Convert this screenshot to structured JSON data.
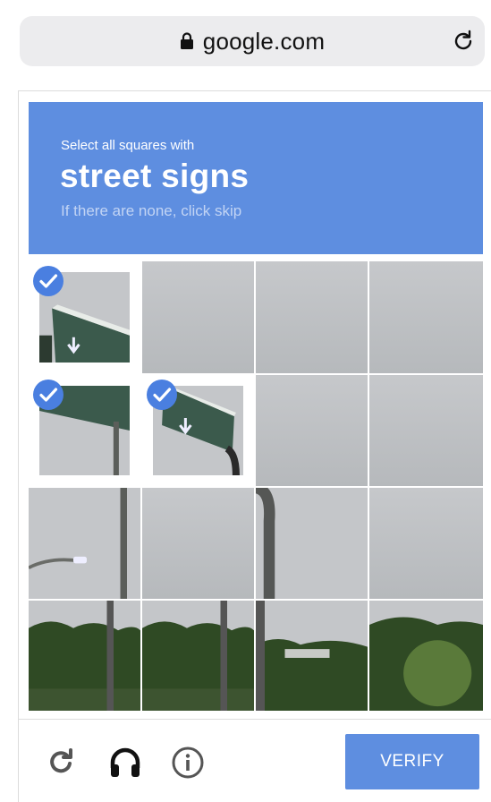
{
  "browser": {
    "url": "google.com"
  },
  "captcha": {
    "instruction": "Select all squares with",
    "target": "street signs",
    "hint": "If there are none, click skip",
    "tiles": [
      {
        "row": 0,
        "col": 0,
        "selected": true,
        "scene": "sign-top"
      },
      {
        "row": 0,
        "col": 1,
        "selected": false,
        "scene": "sky"
      },
      {
        "row": 0,
        "col": 2,
        "selected": false,
        "scene": "sky"
      },
      {
        "row": 0,
        "col": 3,
        "selected": false,
        "scene": "sky"
      },
      {
        "row": 1,
        "col": 0,
        "selected": true,
        "scene": "sign-pole"
      },
      {
        "row": 1,
        "col": 1,
        "selected": true,
        "scene": "sign-small"
      },
      {
        "row": 1,
        "col": 2,
        "selected": false,
        "scene": "sky"
      },
      {
        "row": 1,
        "col": 3,
        "selected": false,
        "scene": "sky"
      },
      {
        "row": 2,
        "col": 0,
        "selected": false,
        "scene": "pole-light"
      },
      {
        "row": 2,
        "col": 1,
        "selected": false,
        "scene": "sky"
      },
      {
        "row": 2,
        "col": 2,
        "selected": false,
        "scene": "pole-curve"
      },
      {
        "row": 2,
        "col": 3,
        "selected": false,
        "scene": "sky"
      },
      {
        "row": 3,
        "col": 0,
        "selected": false,
        "scene": "trees"
      },
      {
        "row": 3,
        "col": 1,
        "selected": false,
        "scene": "trees"
      },
      {
        "row": 3,
        "col": 2,
        "selected": false,
        "scene": "trees-road"
      },
      {
        "row": 3,
        "col": 3,
        "selected": false,
        "scene": "bush"
      }
    ]
  },
  "toolbar": {
    "reload_icon": "reload-icon",
    "audio_icon": "headphones-icon",
    "info_icon": "info-icon",
    "verify_label": "VERIFY"
  },
  "colors": {
    "accent": "#5e8ee0",
    "check": "#4a7fe0",
    "sky": "#c4c6c9",
    "sign_green": "#3b5a4c",
    "tree_green": "#2f4a24"
  }
}
